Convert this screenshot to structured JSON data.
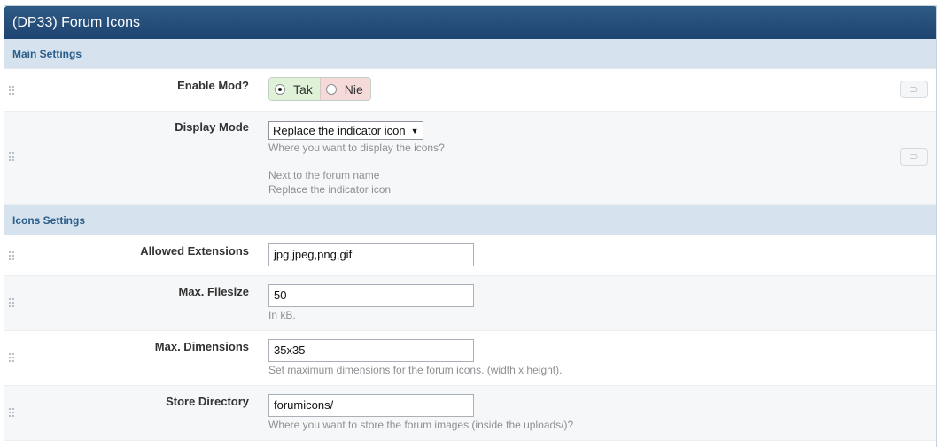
{
  "title": "(DP33) Forum Icons",
  "main_settings": {
    "header": "Main Settings",
    "enable_mod": {
      "label": "Enable Mod?",
      "yes": "Tak",
      "no": "Nie",
      "selected": "yes"
    },
    "display_mode": {
      "label": "Display Mode",
      "selected": "Replace the indicator icon",
      "description": "Where you want to display the icons?",
      "options": [
        "Next to the forum name",
        "Replace the indicator icon"
      ]
    }
  },
  "icons_settings": {
    "header": "Icons Settings",
    "allowed_extensions": {
      "label": "Allowed Extensions",
      "value": "jpg,jpeg,png,gif"
    },
    "max_filesize": {
      "label": "Max. Filesize",
      "value": "50",
      "description": "In kB."
    },
    "max_dimensions": {
      "label": "Max. Dimensions",
      "value": "35x35",
      "description": "Set maximum dimensions for the forum icons. (width x height)."
    },
    "store_directory": {
      "label": "Store Directory",
      "value": "forumicons/",
      "description": "Where you want to store the forum images (inside the uploads/)?"
    }
  },
  "icons": {
    "drag": "drag-handle-icon",
    "revert": "revert-icon",
    "dropdown": "chevron-down-icon"
  },
  "colors": {
    "titlebar": "#1e4470",
    "section_header": "#d6e3ef",
    "yes_bg": "#dff2d8",
    "no_bg": "#f6d9d9"
  }
}
